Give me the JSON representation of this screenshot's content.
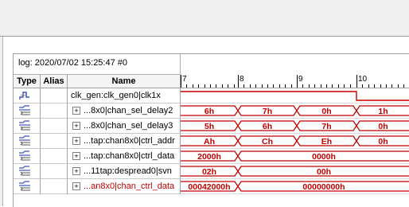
{
  "log": {
    "label": "log: 2020/07/02 15:25:47  #0"
  },
  "headers": {
    "type": "Type",
    "alias": "Alias",
    "name": "Name"
  },
  "ruler": {
    "ticks": [
      "7",
      "8",
      "9",
      "10"
    ]
  },
  "colors": {
    "wave": "#c00000",
    "grid": "#a0a0a0"
  },
  "rows": [
    {
      "icon": "clock-signal-icon",
      "expand": false,
      "name": "clk_gen:clk_gen0|clk1x",
      "name_color": "#000000"
    },
    {
      "icon": "bus-signal-icon",
      "expand": true,
      "name": "...8x0|chan_sel_delay2",
      "name_color": "#000000",
      "values": [
        "6h",
        "7h",
        "0h",
        "1h"
      ]
    },
    {
      "icon": "bus-signal-icon",
      "expand": true,
      "name": "...8x0|chan_sel_delay3",
      "name_color": "#000000",
      "values": [
        "5h",
        "6h",
        "7h",
        "0h"
      ]
    },
    {
      "icon": "bus-signal-icon",
      "expand": true,
      "name": "...tap:chan8x0|ctrl_addr",
      "name_color": "#000000",
      "values": [
        "Ah",
        "Ch",
        "Eh",
        "0h"
      ]
    },
    {
      "icon": "bus-signal-icon",
      "expand": true,
      "name": "...tap:chan8x0|ctrl_data",
      "name_color": "#000000",
      "values": [
        "2000h",
        "0000h"
      ]
    },
    {
      "icon": "bus-signal-icon",
      "expand": true,
      "name": "...11tap:despread0|svn",
      "name_color": "#000000",
      "values": [
        "02h",
        "00h"
      ]
    },
    {
      "icon": "bus-signal-icon",
      "expand": true,
      "name": "...an8x0|chan_ctrl_data",
      "name_color": "#c00000",
      "values": [
        "00042000h",
        "00000000h"
      ]
    }
  ]
}
